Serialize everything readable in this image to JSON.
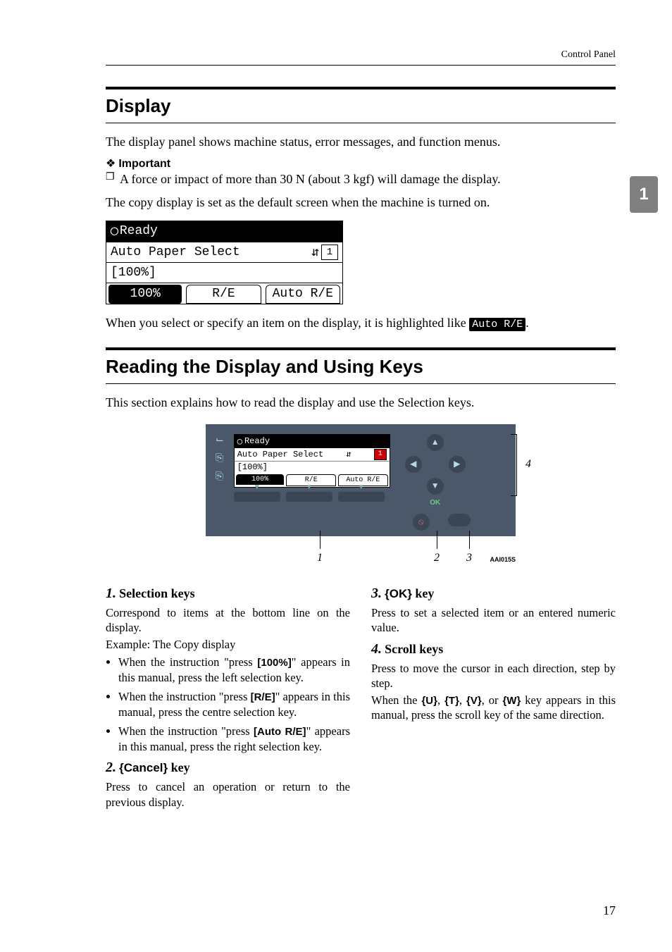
{
  "header": {
    "section": "Control Panel"
  },
  "chapter_tab": "1",
  "h_display": "Display",
  "p_intro": "The display panel shows machine status, error messages, and function menus.",
  "important": {
    "icon": "❖",
    "label": "Important",
    "item": "A force or impact of more than 30 N (about 3 kgf) will damage the display."
  },
  "p_default": "The copy display is set as the default screen when the machine is turned on.",
  "lcd1": {
    "status_icon": "◯",
    "status": "Ready",
    "row2": "Auto Paper Select",
    "paper_arrows": "⇵",
    "paper_num": "1",
    "row3": "[100%]",
    "btn1": "100%",
    "btn2": "R/E",
    "btn3": "Auto R/E"
  },
  "p_highlight_pre": "When you select or specify an item on the display, it is highlighted like ",
  "highlight_sample": "Auto R/E",
  "p_highlight_post": ".",
  "h_reading": "Reading the Display and Using Keys",
  "p_reading_intro": "This section explains how to read the display and use the Selection keys.",
  "panel": {
    "lcd": {
      "status_icon": "◯",
      "status": "Ready",
      "row2": "Auto Paper Select",
      "paper_num": "1",
      "row3": "[100%]",
      "btn1": "100%",
      "btn2": "R/E",
      "btn3": "Auto R/E"
    },
    "ok": "OK",
    "callouts": {
      "c1": "1",
      "c2": "2",
      "c3": "3",
      "c4": "4"
    },
    "fig_id": "AAI015S"
  },
  "items": {
    "i1": {
      "num": "1.",
      "title": "Selection keys",
      "p1": "Correspond to items at the bottom line on the display.",
      "p2": "Example: The Copy display",
      "b1a": "When the instruction \"press ",
      "b1k": "[100%]",
      "b1b": "\" appears in this manual, press the left selection key.",
      "b2a": "When the instruction \"press ",
      "b2k": "[R/E]",
      "b2b": "\" appears in this manual, press the centre selection key.",
      "b3a": "When the instruction \"press ",
      "b3k": "[Auto R/E]",
      "b3b": "\" appears in this manual, press the right selection key."
    },
    "i2": {
      "num": "2.",
      "lb": "{",
      "key": "Cancel",
      "rb": "}",
      "tail": " key",
      "p": "Press to cancel an operation or return to the previous display."
    },
    "i3": {
      "num": "3.",
      "lb": "{",
      "key": "OK",
      "rb": "}",
      "tail": " key",
      "p": "Press to set a selected item or an entered numeric value."
    },
    "i4": {
      "num": "4.",
      "title": "Scroll keys",
      "p1": "Press to move the cursor in each direction, step by step.",
      "p2a": "When the ",
      "kU": "{U}",
      "kD": "{T}",
      "kL": "{V}",
      "kR": "{W}",
      "sep": ", ",
      "or": ", or ",
      "p2b": " key appears in this manual, press the scroll key of the same direction."
    }
  },
  "page_number": "17"
}
